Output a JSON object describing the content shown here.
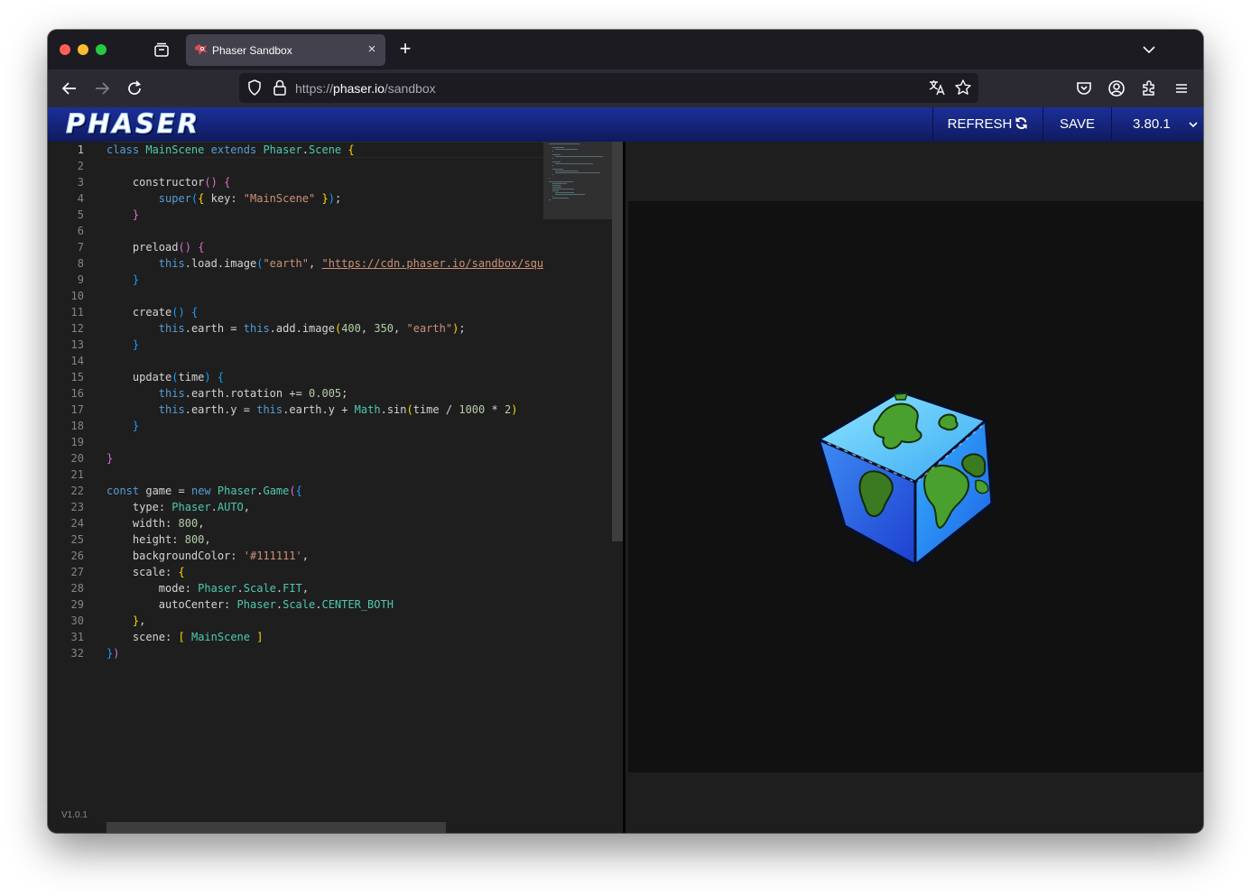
{
  "browser": {
    "tab_title": "Phaser Sandbox",
    "tab_close": "×",
    "new_tab": "+",
    "url_scheme": "https://",
    "url_host": "phaser.io",
    "url_path": "/sandbox"
  },
  "header": {
    "logo_text": "PHASER",
    "refresh_label": "REFRESH",
    "save_label": "SAVE",
    "version_label": "3.80.1"
  },
  "editor": {
    "active_line": 1,
    "line_numbers": [
      "1",
      "2",
      "3",
      "4",
      "5",
      "6",
      "7",
      "8",
      "9",
      "10",
      "11",
      "12",
      "13",
      "14",
      "15",
      "16",
      "17",
      "18",
      "19",
      "20",
      "21",
      "22",
      "23",
      "24",
      "25",
      "26",
      "27",
      "28",
      "29",
      "30",
      "31",
      "32"
    ],
    "code_lines": [
      "class MainScene extends Phaser.Scene {",
      "",
      "    constructor() {",
      "        super({ key: \"MainScene\" });",
      "    }",
      "",
      "    preload() {",
      "        this.load.image(\"earth\", \"https://cdn.phaser.io/sandbox/squ",
      "    }",
      "",
      "    create() {",
      "        this.earth = this.add.image(400, 350, \"earth\");",
      "    }",
      "",
      "    update(time) {",
      "        this.earth.rotation += 0.005;",
      "        this.earth.y = this.earth.y + Math.sin(time / 1000 * 2)",
      "    }",
      "",
      "}",
      "",
      "const game = new Phaser.Game({",
      "    type: Phaser.AUTO,",
      "    width: 800,",
      "    height: 800,",
      "    backgroundColor: '#111111',",
      "    scale: {",
      "        mode: Phaser.Scale.FIT,",
      "        autoCenter: Phaser.Scale.CENTER_BOTH",
      "    },",
      "    scene: [ MainScene ]",
      "})"
    ],
    "sandbox_version": "V1.0.1"
  },
  "preview": {
    "background": "#111111",
    "sprite": "earth-cube"
  },
  "colors": {
    "header_blue": "#15247a",
    "keyword": "#569cd6",
    "class": "#4ec9b0",
    "function": "#dcdcaa",
    "string": "#ce9178",
    "number": "#b5cea8"
  },
  "icons": [
    "tab-overview-icon",
    "phaser-favicon-icon",
    "close-icon",
    "plus-icon",
    "chevron-down-icon",
    "back-arrow-icon",
    "forward-arrow-icon",
    "reload-icon",
    "shield-icon",
    "lock-icon",
    "translate-icon",
    "star-icon",
    "pocket-icon",
    "account-icon",
    "extensions-icon",
    "menu-icon",
    "refresh-icon"
  ]
}
